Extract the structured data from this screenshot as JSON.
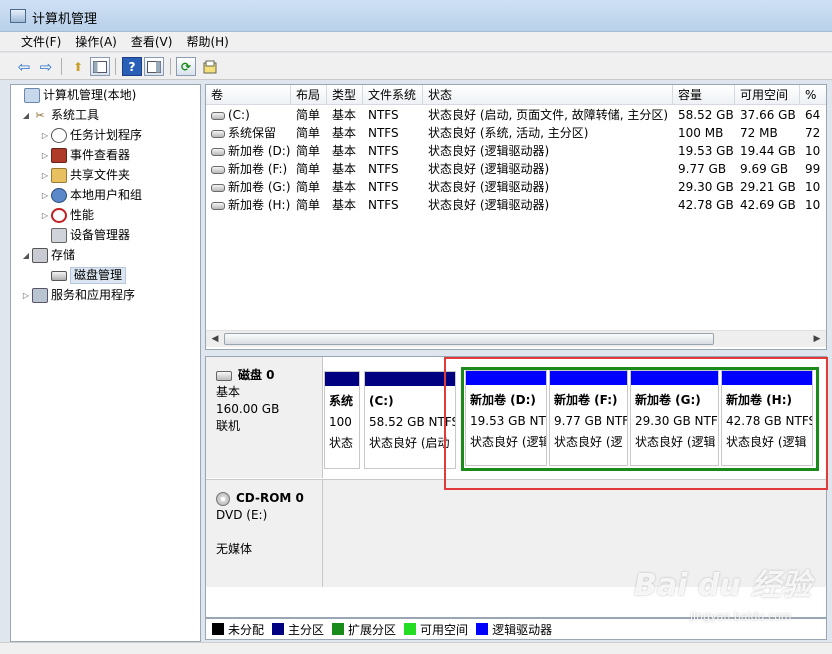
{
  "window": {
    "title": "计算机管理"
  },
  "menu": [
    "文件(F)",
    "操作(A)",
    "查看(V)",
    "帮助(H)"
  ],
  "toolbar_icons": [
    "back-icon",
    "forward-icon",
    "up-folder-icon",
    "show-tree-icon",
    "help-icon",
    "properties-icon",
    "refresh-icon",
    "export-icon"
  ],
  "toolbar_glyphs": {
    "back": "⇦",
    "forward": "⇨",
    "up": "⬆",
    "help": "?",
    "refresh": "⟳"
  },
  "tree": {
    "root": "计算机管理(本地)",
    "system_tools": "系统工具",
    "task_scheduler": "任务计划程序",
    "event_viewer": "事件查看器",
    "shared_folders": "共享文件夹",
    "local_users": "本地用户和组",
    "performance": "性能",
    "device_manager": "设备管理器",
    "storage": "存储",
    "disk_management": "磁盘管理",
    "services_apps": "服务和应用程序"
  },
  "volumes": {
    "columns": [
      "卷",
      "布局",
      "类型",
      "文件系统",
      "状态",
      "容量",
      "可用空间",
      "%"
    ],
    "rows": [
      [
        "(C:)",
        "简单",
        "基本",
        "NTFS",
        "状态良好 (启动, 页面文件, 故障转储, 主分区)",
        "58.52 GB",
        "37.66 GB",
        "64"
      ],
      [
        "系统保留",
        "简单",
        "基本",
        "NTFS",
        "状态良好 (系统, 活动, 主分区)",
        "100 MB",
        "72 MB",
        "72"
      ],
      [
        "新加卷 (D:)",
        "简单",
        "基本",
        "NTFS",
        "状态良好 (逻辑驱动器)",
        "19.53 GB",
        "19.44 GB",
        "10"
      ],
      [
        "新加卷 (F:)",
        "简单",
        "基本",
        "NTFS",
        "状态良好 (逻辑驱动器)",
        "9.77 GB",
        "9.69 GB",
        "99"
      ],
      [
        "新加卷 (G:)",
        "简单",
        "基本",
        "NTFS",
        "状态良好 (逻辑驱动器)",
        "29.30 GB",
        "29.21 GB",
        "10"
      ],
      [
        "新加卷 (H:)",
        "简单",
        "基本",
        "NTFS",
        "状态良好 (逻辑驱动器)",
        "42.78 GB",
        "42.69 GB",
        "10"
      ]
    ]
  },
  "disk0": {
    "name": "磁盘 0",
    "type": "基本",
    "size": "160.00 GB",
    "state": "联机",
    "partitions": [
      {
        "line1": "系统",
        "line2": "100",
        "line3": "状态",
        "color": "#000080"
      },
      {
        "line1": "(C:)",
        "line2": "58.52 GB NTFS",
        "line3": "状态良好 (启动",
        "color": "#000080"
      },
      {
        "line1": "新加卷 (D:)",
        "line2": "19.53 GB NTFS",
        "line3": "状态良好 (逻辑",
        "color": "#0000ff"
      },
      {
        "line1": "新加卷 (F:)",
        "line2": "9.77 GB NTFS",
        "line3": "状态良好 (逻",
        "color": "#0000ff"
      },
      {
        "line1": "新加卷 (G:)",
        "line2": "29.30 GB NTFS",
        "line3": "状态良好 (逻辑",
        "color": "#0000ff"
      },
      {
        "line1": "新加卷 (H:)",
        "line2": "42.78 GB NTFS",
        "line3": "状态良好 (逻辑",
        "color": "#0000ff"
      }
    ]
  },
  "cdrom": {
    "name": "CD-ROM 0",
    "drive": "DVD (E:)",
    "media": "无媒体"
  },
  "legend": [
    {
      "label": "未分配",
      "color": "#000000"
    },
    {
      "label": "主分区",
      "color": "#000080"
    },
    {
      "label": "扩展分区",
      "color": "#1a8a1a"
    },
    {
      "label": "可用空间",
      "color": "#22dd22"
    },
    {
      "label": "逻辑驱动器",
      "color": "#0000ff"
    }
  ],
  "watermark": {
    "brand": "Bai du 经验",
    "site": "jingyan.baidu.com"
  }
}
